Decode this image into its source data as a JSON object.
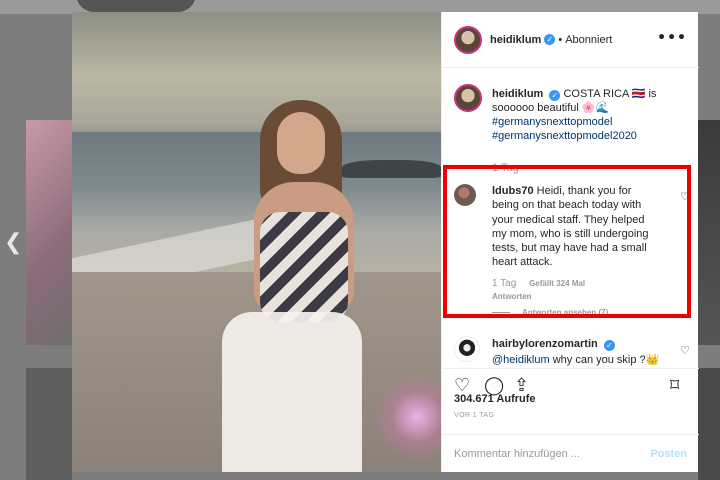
{
  "header": {
    "username": "heidiklum",
    "separator": "•",
    "follow_status": "Abonniert",
    "more_icon": "more-options-icon"
  },
  "caption": {
    "username": "heidiklum",
    "text": "COSTA RICA 🇨🇷 is soooooo beautiful 🌸🌊",
    "hashtags": [
      "#germanysnexttopmodel",
      "#germanysnexttopmodel2020"
    ],
    "time": "1 Tag"
  },
  "comments": [
    {
      "username": "ldubs70",
      "text": "Heidi, thank you for being on that beach today with your medical staff. They helped my mom, who is still undergoing tests, but may have had a small heart attack.",
      "time": "1 Tag",
      "likes": "Gefällt 324 Mal",
      "reply": "Antworten",
      "view_replies": "Antworten ansehen (7)"
    },
    {
      "username": "hairbylorenzomartin",
      "mention": "@heidiklum",
      "text": "why can you skip ?👑"
    }
  ],
  "actions": {
    "icons": [
      "heart-icon",
      "comment-icon",
      "share-icon",
      "bookmark-icon"
    ]
  },
  "views": "304.671 Aufrufe",
  "date": "VOR 1 TAG",
  "comment_input": {
    "placeholder": "Kommentar hinzufügen ...",
    "post_label": "Posten"
  },
  "colors": {
    "verified": "#3897f0",
    "highlight": "#ee0000",
    "hashtag": "#003569",
    "post_button": "#b2dffc"
  }
}
